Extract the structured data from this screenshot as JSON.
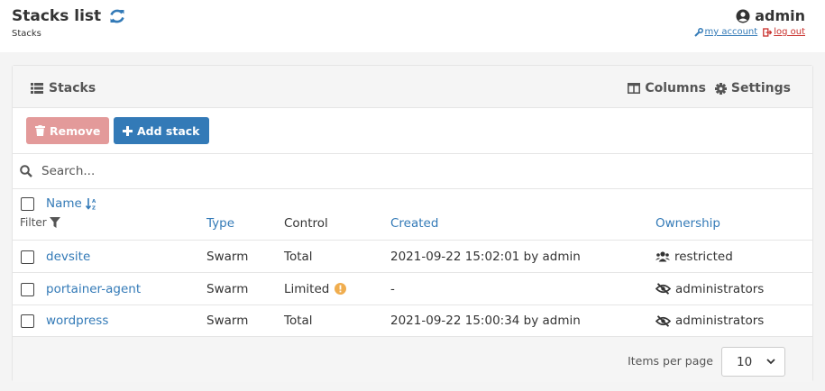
{
  "header": {
    "title": "Stacks list",
    "breadcrumb": "Stacks",
    "user": "admin",
    "my_account": "my account",
    "log_out": "log out"
  },
  "panel": {
    "title": "Stacks",
    "columns_label": "Columns",
    "settings_label": "Settings"
  },
  "toolbar": {
    "remove_label": "Remove",
    "add_label": "Add stack"
  },
  "search": {
    "placeholder": "Search..."
  },
  "table": {
    "headers": {
      "name": "Name",
      "filter": "Filter",
      "type": "Type",
      "control": "Control",
      "created": "Created",
      "ownership": "Ownership"
    },
    "rows": [
      {
        "name": "devsite",
        "type": "Swarm",
        "control": "Total",
        "created": "2021-09-22 15:02:01 by admin",
        "ownership": "restricted",
        "own_icon": "users-icon",
        "info": false
      },
      {
        "name": "portainer-agent",
        "type": "Swarm",
        "control": "Limited",
        "created": "-",
        "ownership": "administrators",
        "own_icon": "eye-slash-icon",
        "info": true
      },
      {
        "name": "wordpress",
        "type": "Swarm",
        "control": "Total",
        "created": "2021-09-22 15:00:34 by admin",
        "ownership": "administrators",
        "own_icon": "eye-slash-icon",
        "info": false
      }
    ]
  },
  "pagination": {
    "label": "Items per page",
    "value": "10"
  },
  "colors": {
    "primary": "#337ab7",
    "danger_disabled": "#e39a9a",
    "warning": "#f0ad4e"
  }
}
